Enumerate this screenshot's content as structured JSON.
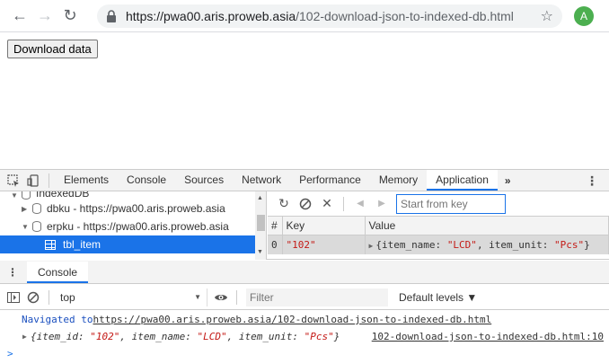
{
  "browser": {
    "url_host": "https://pwa00.aris.proweb.asia",
    "url_path": "/102-download-json-to-indexed-db.html",
    "avatar_letter": "A"
  },
  "page": {
    "download_button": "Download data"
  },
  "devtools": {
    "tabs": [
      "Elements",
      "Console",
      "Sources",
      "Network",
      "Performance",
      "Memory",
      "Application"
    ],
    "active_tab": "Application",
    "more": "»",
    "tree": {
      "cut_label": "IndexedDB",
      "db1": "dbku - https://pwa00.aris.proweb.asia",
      "db2": "erpku - https://pwa00.aris.proweb.asia",
      "store": "tbl_item"
    },
    "idb": {
      "start_placeholder": "Start from key",
      "col_num": "#",
      "col_key": "Key",
      "col_value": "Value",
      "row": {
        "num": "0",
        "key": "\"102\"",
        "value_prefix": "{item_name: ",
        "v1": "\"LCD\"",
        "mid": ", item_unit: ",
        "v2": "\"Pcs\"",
        "value_suffix": "}"
      }
    },
    "drawer_tab": "Console",
    "console": {
      "context": "top",
      "filter_placeholder": "Filter",
      "levels": "Default levels ▼",
      "nav_text": "Navigated to ",
      "nav_link": "https://pwa00.aris.proweb.asia/102-download-json-to-indexed-db.html",
      "log": {
        "open": "{",
        "k1": "item_id: ",
        "v1": "\"102\"",
        "k2": ", item_name: ",
        "v2": "\"LCD\"",
        "k3": ", item_unit: ",
        "v3": "\"Pcs\"",
        "close": "}"
      },
      "log_source": "102-download-json-to-indexed-db.html:10",
      "prompt": ">"
    }
  }
}
